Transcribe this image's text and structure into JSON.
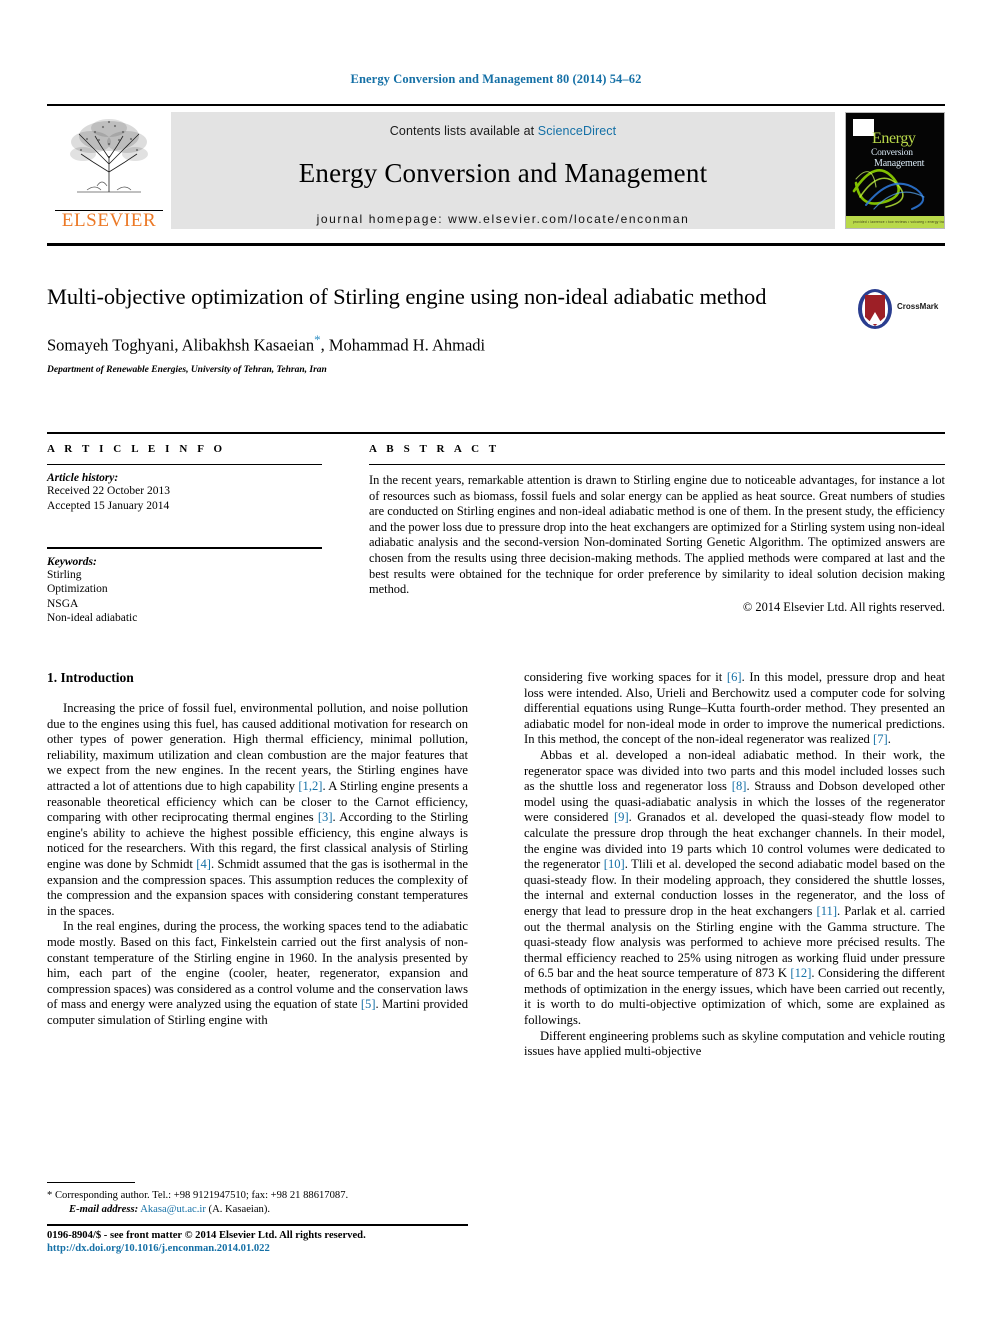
{
  "running_head": "Energy Conversion and Management 80 (2014) 54–62",
  "masthead": {
    "contents_prefix": "Contents lists available at",
    "sciencedirect": "ScienceDirect",
    "journal_title": "Energy Conversion and Management",
    "homepage": "journal homepage: www.elsevier.com/locate/enconman",
    "publisher": "ELSEVIER",
    "cover": {
      "line1": "Energy",
      "line2": "Conversion",
      "line3": "Management",
      "footer_text": "provided • lawrence • tow reviews • volcareg • energy transmissions"
    }
  },
  "article": {
    "title": "Multi-objective optimization of Stirling engine using non-ideal adiabatic method",
    "authors": "Somayeh Toghyani, Alibakhsh Kasaeian",
    "authors_tail": ", Mohammad H. Ahmadi",
    "corresponding_marker": "*",
    "affiliation": "Department of Renewable Energies, University of Tehran, Tehran, Iran",
    "crossmark_label": "CrossMark"
  },
  "article_info": {
    "heading": "A R T I C L E    I N F O",
    "history_label": "Article history:",
    "received": "Received 22 October 2013",
    "accepted": "Accepted 15 January 2014",
    "keywords_label": "Keywords:",
    "keywords": [
      "Stirling",
      "Optimization",
      "NSGA",
      "Non-ideal adiabatic"
    ]
  },
  "abstract": {
    "heading": "A B S T R A C T",
    "text": "In the recent years, remarkable attention is drawn to Stirling engine due to noticeable advantages, for instance a lot of resources such as biomass, fossil fuels and solar energy can be applied as heat source. Great numbers of studies are conducted on Stirling engines and non-ideal adiabatic method is one of them. In the present study, the efficiency and the power loss due to pressure drop into the heat exchangers are optimized for a Stirling system using non-ideal adiabatic analysis and the second-version Non-dominated Sorting Genetic Algorithm. The optimized answers are chosen from the results using three decision-making methods. The applied methods were compared at last and the best results were obtained for the technique for order preference by similarity to ideal solution decision making method.",
    "copyright": "© 2014 Elsevier Ltd. All rights reserved."
  },
  "body": {
    "section_heading": "1. Introduction",
    "left_p1_a": "Increasing the price of fossil fuel, environmental pollution, and noise pollution due to the engines using this fuel, has caused additional motivation for research on other types of power generation. High thermal efficiency, minimal pollution, reliability, maximum utilization and clean combustion are the major features that we expect from the new engines. In the recent years, the Stirling engines have attracted a lot of attentions due to high capability ",
    "left_p1_ref1": "[1,2]",
    "left_p1_b": ". A Stirling engine presents a reasonable theoretical efficiency which can be closer to the Carnot efficiency, comparing with other reciprocating thermal engines ",
    "left_p1_ref2": "[3]",
    "left_p1_c": ". According to the Stirling engine's ability to achieve the highest possible efficiency, this engine always is noticed for the researchers. With this regard, the first classical analysis of Stirling engine was done by Schmidt ",
    "left_p1_ref3": "[4]",
    "left_p1_d": ". Schmidt assumed that the gas is isothermal in the expansion and the compression spaces. This assumption reduces the complexity of the compression and the expansion spaces with considering constant temperatures in the spaces.",
    "left_p2_a": "In the real engines, during the process, the working spaces tend to the adiabatic mode mostly. Based on this fact, Finkelstein carried out the first analysis of non-constant temperature of the Stirling engine in 1960. In the analysis presented by him, each part of the engine (cooler, heater, regenerator, expansion and compression spaces) was considered as a control volume and the conservation laws of mass and energy were analyzed using the equation of state ",
    "left_p2_ref1": "[5]",
    "left_p2_b": ". Martini provided computer simulation of Stirling engine with",
    "right_p1_a": "considering five working spaces for it ",
    "right_p1_ref1": "[6]",
    "right_p1_b": ". In this model, pressure drop and heat loss were intended. Also, Urieli and Berchowitz used a computer code for solving differential equations using Runge–Kutta fourth-order method. They presented an adiabatic model for non-ideal mode in order to improve the numerical predictions. In this method, the concept of the non-ideal regenerator was realized ",
    "right_p1_ref2": "[7]",
    "right_p1_c": ".",
    "right_p2_a": "Abbas et al. developed a non-ideal adiabatic method. In their work, the regenerator space was divided into two parts and this model included losses such as the shuttle loss and regenerator loss ",
    "right_p2_ref1": "[8]",
    "right_p2_b": ". Strauss and Dobson developed other model using the quasi-adiabatic analysis in which the losses of the regenerator were considered ",
    "right_p2_ref2": "[9]",
    "right_p2_c": ". Granados et al. developed the quasi-steady flow model to calculate the pressure drop through the heat exchanger channels. In their model, the engine was divided into 19 parts which 10 control volumes were dedicated to the regenerator ",
    "right_p2_ref3": "[10]",
    "right_p2_d": ". Tlili et al. developed the second adiabatic model based on the quasi-steady flow. In their modeling approach, they considered the shuttle losses, the internal and external conduction losses in the regenerator, and the loss of energy that lead to pressure drop in the heat exchangers ",
    "right_p2_ref4": "[11]",
    "right_p2_e": ". Parlak et al. carried out the thermal analysis on the Stirling engine with the Gamma structure. The quasi-steady flow analysis was performed to achieve more précised results. The thermal efficiency reached to 25% using nitrogen as working fluid under pressure of 6.5 bar and the heat source temperature of 873 K ",
    "right_p2_ref5": "[12]",
    "right_p2_f": ". Considering the different methods of optimization in the energy issues, which have been carried out recently, it is worth to do multi-objective optimization of which, some are explained as followings.",
    "right_p3": "Different engineering problems such as skyline computation and vehicle routing issues have applied multi-objective"
  },
  "footnote": {
    "marker": "*",
    "line1": "Corresponding author. Tel.: +98 9121947510; fax: +98 21 88617087.",
    "email_label": "E-mail address:",
    "email": "Akasa@ut.ac.ir",
    "email_suffix": "(A. Kasaeian)."
  },
  "page_footer": {
    "issn_line": "0196-8904/$ - see front matter © 2014 Elsevier Ltd. All rights reserved.",
    "doi": "http://dx.doi.org/10.1016/j.enconman.2014.01.022"
  },
  "colors": {
    "link": "#1570a6",
    "elsevier_orange": "#ec7926",
    "banner_gray": "#e3e3e3"
  }
}
